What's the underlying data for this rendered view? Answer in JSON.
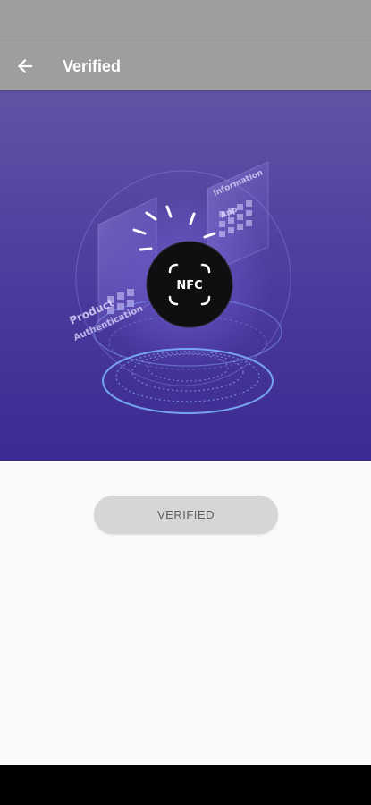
{
  "app_bar": {
    "title": "Verified",
    "back_icon": "arrow-back-icon",
    "background": "#9e9e9e"
  },
  "hero": {
    "illustration": "nfc-tag-authentication",
    "badge_text": "NFC",
    "left_label_line1": "Product",
    "left_label_line2": "Authentication",
    "right_label_line1": "Information",
    "right_label_line2": "App",
    "gradient_top": "#6353a6",
    "gradient_bottom": "#3b2b92"
  },
  "action": {
    "button_label": "VERIFIED",
    "button_background": "#d6d6d6"
  }
}
